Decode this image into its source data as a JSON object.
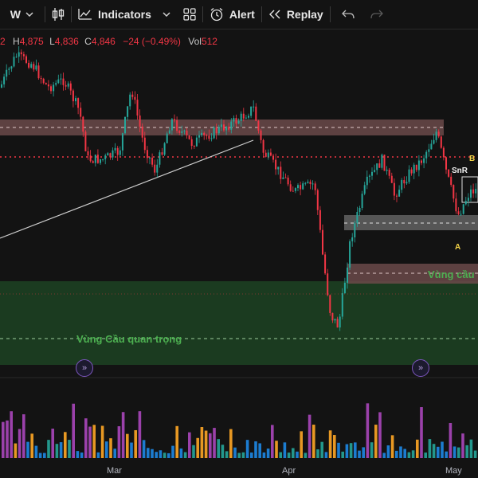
{
  "toolbar": {
    "interval": "W",
    "indicators_label": "Indicators",
    "alert_label": "Alert",
    "replay_label": "Replay"
  },
  "legend": {
    "open_prefix": "2",
    "high_key": "H",
    "high": "4,875",
    "low_key": "L",
    "low": "4,836",
    "close_key": "C",
    "close": "4,846",
    "change": "−24 (−0.49%)",
    "vol_key": "Vol",
    "vol": "512"
  },
  "annotations": {
    "demand_zone": "Vùng cầu",
    "key_demand_zone": "Vùng Cầu quan trọng",
    "snr": "SnR",
    "marker_a": "A",
    "marker_b": "B"
  },
  "axis": {
    "x_labels": [
      "Mar",
      "Apr",
      "May"
    ]
  },
  "colors": {
    "up": "#26a69a",
    "down": "#f23645",
    "volume_highlight": "#ab47bc",
    "volume_mid": "#ffa726",
    "zone_resistance": "#6b4a4a",
    "zone_demand": "#1f4a25",
    "dotted_red": "#f23645"
  },
  "chart_data": {
    "type": "candlestick",
    "y_range": [
      4700,
      5000
    ]
  }
}
